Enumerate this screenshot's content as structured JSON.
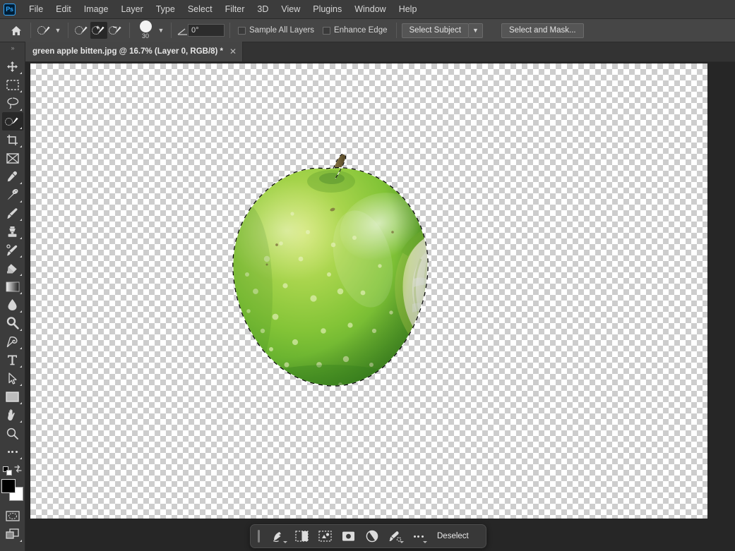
{
  "app": {
    "name": "Adobe Photoshop",
    "logo_text": "Ps",
    "logo_icon": "photoshop-logo-icon"
  },
  "menubar": {
    "items": [
      {
        "label": "File"
      },
      {
        "label": "Edit"
      },
      {
        "label": "Image"
      },
      {
        "label": "Layer"
      },
      {
        "label": "Type"
      },
      {
        "label": "Select"
      },
      {
        "label": "Filter"
      },
      {
        "label": "3D"
      },
      {
        "label": "View"
      },
      {
        "label": "Plugins"
      },
      {
        "label": "Window"
      },
      {
        "label": "Help"
      }
    ]
  },
  "options_bar": {
    "home_icon": "home-icon",
    "tool_preset": {
      "icon": "quick-selection-tool-icon",
      "chevron": "chevron-down-icon"
    },
    "selection_modes": [
      {
        "name": "new-selection",
        "icon": "new-selection-icon",
        "active": false
      },
      {
        "name": "add-to-selection",
        "icon": "add-to-selection-icon",
        "active": true
      },
      {
        "name": "subtract-from-selection",
        "icon": "subtract-from-selection-icon",
        "active": false
      }
    ],
    "brush": {
      "size_label": "30",
      "preview_icon": "brush-preview-icon",
      "chevron": "chevron-down-icon"
    },
    "angle": {
      "icon": "angle-icon",
      "value": "0°"
    },
    "sample_all_layers": {
      "label": "Sample All Layers",
      "checked": false
    },
    "enhance_edge": {
      "label": "Enhance Edge",
      "checked": false
    },
    "select_subject": {
      "label": "Select Subject",
      "chevron": "chevron-down-icon"
    },
    "select_and_mask": {
      "label": "Select and Mask..."
    }
  },
  "tab_bar": {
    "tabs": [
      {
        "title": "green apple bitten.jpg @ 16.7% (Layer 0, RGB/8) *",
        "close_icon": "close-icon",
        "active": true
      }
    ]
  },
  "tools_panel": {
    "expand_icon": "double-chevron-right-icon",
    "tools": [
      {
        "name": "move-tool",
        "icon": "move-icon",
        "active": false,
        "has_flyout": true
      },
      {
        "name": "rectangular-marquee-tool",
        "icon": "marquee-icon",
        "active": false,
        "has_flyout": true
      },
      {
        "name": "lasso-tool",
        "icon": "lasso-icon",
        "active": false,
        "has_flyout": true
      },
      {
        "name": "quick-selection-tool",
        "icon": "quick-selection-icon",
        "active": true,
        "has_flyout": true
      },
      {
        "name": "crop-tool",
        "icon": "crop-icon",
        "active": false,
        "has_flyout": true
      },
      {
        "name": "frame-tool",
        "icon": "frame-icon",
        "active": false,
        "has_flyout": false
      },
      {
        "name": "eyedropper-tool",
        "icon": "eyedropper-icon",
        "active": false,
        "has_flyout": true
      },
      {
        "name": "spot-healing-brush-tool",
        "icon": "healing-brush-icon",
        "active": false,
        "has_flyout": true
      },
      {
        "name": "brush-tool",
        "icon": "brush-icon",
        "active": false,
        "has_flyout": true
      },
      {
        "name": "clone-stamp-tool",
        "icon": "clone-stamp-icon",
        "active": false,
        "has_flyout": true
      },
      {
        "name": "history-brush-tool",
        "icon": "history-brush-icon",
        "active": false,
        "has_flyout": true
      },
      {
        "name": "eraser-tool",
        "icon": "eraser-icon",
        "active": false,
        "has_flyout": true
      },
      {
        "name": "gradient-tool",
        "icon": "gradient-icon",
        "active": false,
        "has_flyout": true
      },
      {
        "name": "blur-tool",
        "icon": "blur-droplet-icon",
        "active": false,
        "has_flyout": true
      },
      {
        "name": "dodge-tool",
        "icon": "dodge-icon",
        "active": false,
        "has_flyout": true
      },
      {
        "name": "pen-tool",
        "icon": "pen-icon",
        "active": false,
        "has_flyout": true
      },
      {
        "name": "type-tool",
        "icon": "type-t-icon",
        "active": false,
        "has_flyout": true
      },
      {
        "name": "path-selection-tool",
        "icon": "path-arrow-icon",
        "active": false,
        "has_flyout": true
      },
      {
        "name": "rectangle-tool",
        "icon": "rectangle-shape-icon",
        "active": false,
        "has_flyout": true
      },
      {
        "name": "hand-tool",
        "icon": "hand-icon",
        "active": false,
        "has_flyout": true
      },
      {
        "name": "zoom-tool",
        "icon": "zoom-magnifier-icon",
        "active": false,
        "has_flyout": false
      },
      {
        "name": "edit-toolbar",
        "icon": "more-ellipsis-icon",
        "active": false,
        "has_flyout": true
      }
    ],
    "default_colors_icon": "default-colors-icon",
    "swap_colors_icon": "swap-colors-icon",
    "foreground_color": "#000000",
    "background_color": "#ffffff",
    "quick_mask_icon": "quick-mask-icon",
    "screen_mode_icon": "screen-mode-icon"
  },
  "canvas": {
    "zoom_level": "16.7%",
    "transparent_background": true,
    "selection_active": true,
    "artwork": {
      "name": "green-apple-bitten",
      "description": "Green Granny Smith apple with a bite taken out of the right side",
      "colors": {
        "skin_light": "#b8d94a",
        "skin_mid": "#7ec13a",
        "skin_dark": "#4f9e2a",
        "skin_highlight": "#e4f0ae",
        "flesh": "#eef3cf",
        "flesh_shadow": "#d4e4a6",
        "stem": "#6b5a34"
      }
    }
  },
  "task_bar": {
    "grip_icon": "drag-grip-icon",
    "buttons": [
      {
        "name": "select-subject-button",
        "icon": "select-subject-icon",
        "has_caret": true
      },
      {
        "name": "mask-selection-button",
        "icon": "mask-selection-icon",
        "has_caret": false
      },
      {
        "name": "transform-selection-button",
        "icon": "transform-selection-icon",
        "has_caret": false
      },
      {
        "name": "generative-fill-button",
        "icon": "camera-fill-icon",
        "has_caret": false
      },
      {
        "name": "adjustment-layer-button",
        "icon": "adjustment-circle-icon",
        "has_caret": false
      },
      {
        "name": "remove-background-button",
        "icon": "remove-background-icon",
        "has_caret": true
      },
      {
        "name": "more-options-button",
        "icon": "more-ellipsis-icon",
        "has_caret": true
      }
    ],
    "deselect_label": "Deselect"
  },
  "theme": {
    "menubar_bg": "#3c3c3c",
    "optionsbar_bg": "#464646",
    "panel_bg": "#3c3c3c",
    "workspace_bg": "#262626",
    "tab_active_bg": "#454545",
    "accent": "#31a8ff",
    "text": "#d6d6d6"
  }
}
